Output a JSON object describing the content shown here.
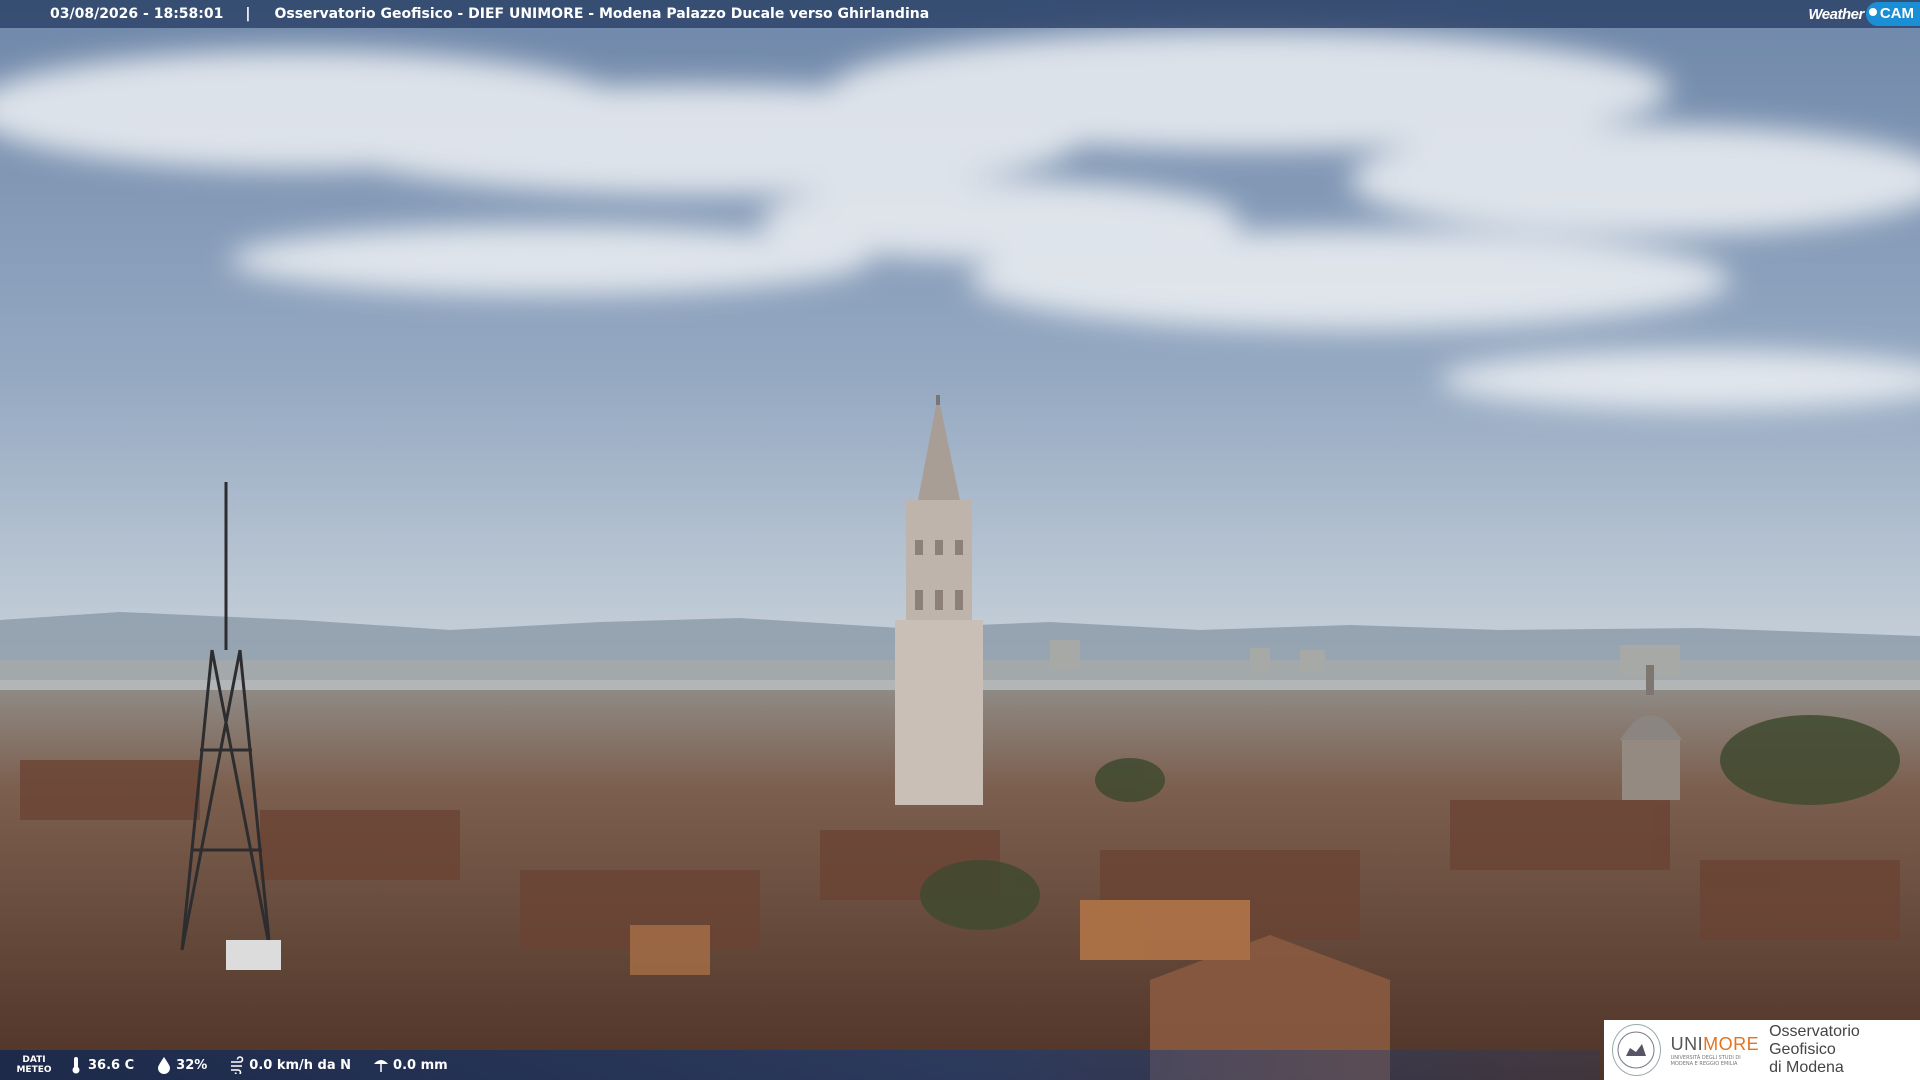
{
  "overlay": {
    "timestamp": "03/08/2026 - 18:58:01",
    "separator": "|",
    "title": "Osservatorio Geofisico - DIEF UNIMORE - Modena Palazzo Ducale verso Ghirlandina",
    "weathercam_logo": {
      "text_weather": "Weather",
      "text_cam": "CAM"
    }
  },
  "meteo": {
    "label_line1": "DATI",
    "label_line2": "METEO",
    "temperature": "36.6 C",
    "humidity": "32%",
    "wind": "0.0 km/h da N",
    "rain": "0.0 mm",
    "icons": [
      "thermometer-icon",
      "humidity-drop-icon",
      "wind-icon",
      "rain-gauge-icon"
    ]
  },
  "logo": {
    "brand_a": "UNI",
    "brand_b": "MORE",
    "brand_sub": "UNIVERSITÀ DEGLI STUDI DI MODENA E REGGIO EMILIA",
    "observatory_line1": "Osservatorio Geofisico",
    "observatory_line2": "di Modena",
    "accent": "#e3731f"
  },
  "colors": {
    "sky_top": "#7c93b3",
    "sky_bottom": "#d9dfe3",
    "roofs": "#7a4a35"
  }
}
